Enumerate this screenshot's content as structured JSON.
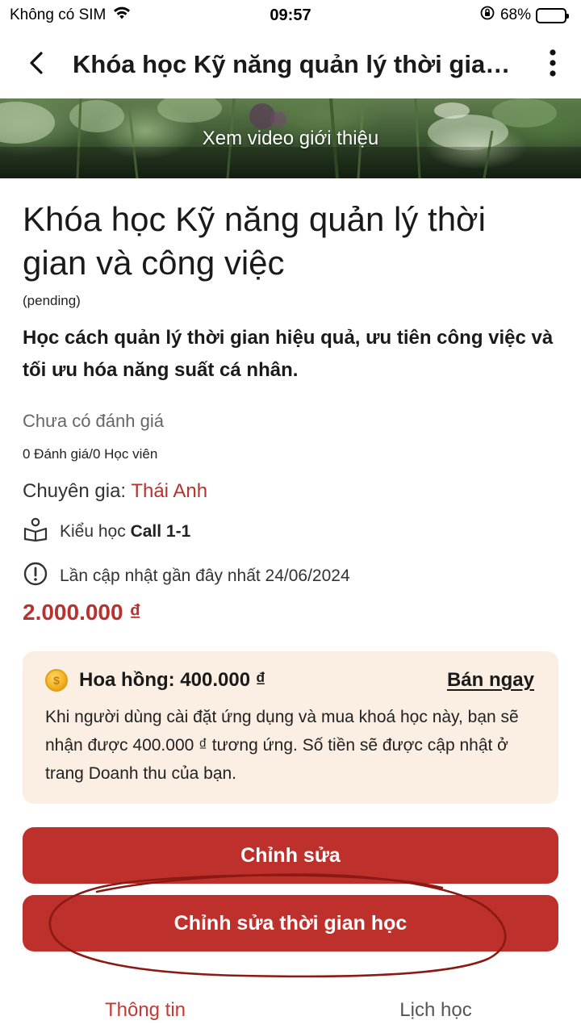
{
  "status_bar": {
    "carrier": "Không có SIM",
    "time": "09:57",
    "battery": "68%",
    "battery_level": 0.68
  },
  "header": {
    "title": "Khóa học Kỹ năng quản lý thời gian và công việc",
    "back_icon": "chevron-left-icon",
    "more_icon": "more-vertical-icon"
  },
  "banner": {
    "label": "Xem video giới thiệu"
  },
  "course": {
    "title": "Khóa học Kỹ năng quản lý thời gian và công việc",
    "status": "(pending)",
    "description": "Học cách quản lý thời gian hiệu quả, ưu tiên công việc và tối ưu hóa năng suất cá nhân.",
    "rating_text": "Chưa có đánh giá",
    "review_count": "0 Đánh giá/0 Học viên",
    "expert_label": "Chuyên gia:",
    "expert_name": "Thái Anh",
    "learn_type_label": "Kiểu học",
    "learn_type_value": "Call 1-1",
    "last_update": "Lần cập nhật gần đây nhất 24/06/2024",
    "price": "2.000.000 ₫"
  },
  "commission": {
    "label": "Hoa hồng: 400.000 ₫",
    "action": "Bán ngay",
    "description": "Khi người dùng cài đặt ứng dụng và mua khoá học này, bạn sẽ nhận được 400.000 ₫ tương ứng. Số tiền sẽ được cập nhật ở trang Doanh thu của bạn."
  },
  "buttons": {
    "edit": "Chỉnh sửa",
    "edit_time": "Chỉnh sửa thời gian học"
  },
  "tabs": [
    {
      "label": "Thông tin",
      "active": true
    },
    {
      "label": "Lịch học",
      "active": false
    }
  ],
  "colors": {
    "accent": "#bd302c",
    "price": "#b7332f",
    "commission_bg": "#fbeee2",
    "annotation": "#8b1a14"
  }
}
